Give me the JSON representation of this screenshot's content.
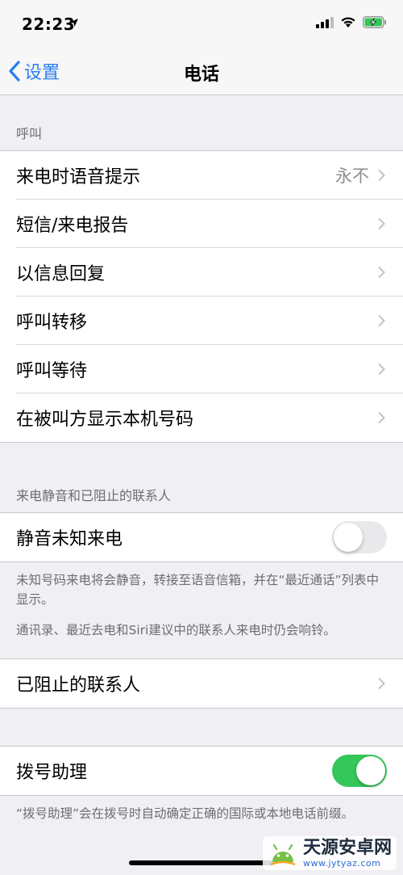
{
  "status_bar": {
    "time": "22:23"
  },
  "nav": {
    "back_label": "设置",
    "title": "电话"
  },
  "calls_section": {
    "header": "呼叫",
    "items": [
      {
        "label": "来电时语音提示",
        "value": "永不"
      },
      {
        "label": "短信/来电报告"
      },
      {
        "label": "以信息回复"
      },
      {
        "label": "呼叫转移"
      },
      {
        "label": "呼叫等待"
      },
      {
        "label": "在被叫方显示本机号码"
      }
    ]
  },
  "silence_section": {
    "header": "来电静音和已阻止的联系人",
    "silence_unknown": {
      "label": "静音未知来电",
      "enabled": false
    },
    "footer_1": "未知号码来电将会静音，转接至语音信箱，并在“最近通话”列表中显示。",
    "footer_2": "通讯录、最近去电和Siri建议中的联系人来电时仍会响铃。",
    "blocked": {
      "label": "已阻止的联系人"
    }
  },
  "dial_section": {
    "dial_assist": {
      "label": "拨号助理",
      "enabled": true
    },
    "footer": "“拨号助理”会在拨号时自动确定正确的国际或本地电话前缀。"
  },
  "watermark": {
    "title": "天源安卓网",
    "url": "www.jytyaz.com"
  },
  "colors": {
    "accent": "#2a7ef2",
    "toggle_on": "#35c759",
    "background": "#efeff4"
  }
}
